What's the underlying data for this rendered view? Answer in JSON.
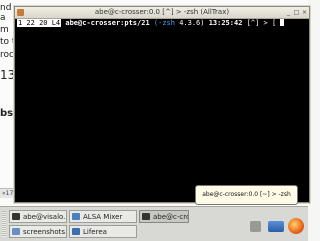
{
  "background": {
    "snippets": [
      "nd",
      "a",
      "m",
      "to t",
      "roc",
      "13",
      "bsh"
    ],
    "footer": "«17"
  },
  "terminal": {
    "title": "abe@c-crosser:0.0 [^] > -zsh (AllTrax)",
    "prompt": {
      "time_badge": "1 22 20 L4",
      "user_host": "abe@c-crosser:pts/21",
      "shell": "(-zsh",
      "version": "4.3.6)",
      "clock": "13:25:42",
      "cwd": "[^] >",
      "cursor_char": "["
    }
  },
  "notification": {
    "text": "abe@c-crosser:0.0 [~] > -zsh"
  },
  "taskbar": {
    "row1": [
      {
        "label": "abe@visalo...",
        "icon_color": "#333333"
      },
      {
        "label": "ALSA Mixer",
        "icon_color": "#4a7fc0"
      },
      {
        "label": "abe@c-cros...",
        "icon_color": "#333333"
      }
    ],
    "row2": [
      {
        "label": "screenshots...",
        "icon_color": "#6a8fc8"
      },
      {
        "label": "Liferea",
        "icon_color": "#3d6fb0"
      }
    ]
  }
}
